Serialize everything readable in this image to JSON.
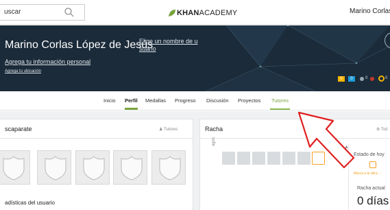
{
  "topbar": {
    "search_text": "uscar",
    "search_icon": "search-icon",
    "logo_strong": "KHAN",
    "logo_light": "ACADEMY",
    "user_name": "Marino Corlas"
  },
  "header": {
    "profile_name": "Marino Corlas López de Jesús",
    "pick_name_link": "Elige un nombre de u suario",
    "add_info_link": "Agrega tu información personal",
    "add_location_link": "Agrega tu ubicación",
    "badge_energy": "0",
    "badge_count": "0",
    "stat_a": "0",
    "stat_b": "0"
  },
  "nav": {
    "items": [
      {
        "label": "Inicio",
        "state": "normal"
      },
      {
        "label": "Perfil",
        "state": "active"
      },
      {
        "label": "Medallas",
        "state": "normal"
      },
      {
        "label": "Progreso",
        "state": "normal"
      },
      {
        "label": "Discusión",
        "state": "normal"
      },
      {
        "label": "Proyectos",
        "state": "normal"
      },
      {
        "label": "Tutores",
        "state": "highlighted"
      }
    ]
  },
  "showcase": {
    "title": "scaparate",
    "action": "Tutores",
    "stats_title": "adísticas del usuario"
  },
  "streak": {
    "title": "Racha",
    "action": "Tod",
    "y_label": "agos",
    "today_title": "Estado de hoy",
    "today_note": "Marca a la obra →",
    "current_label": "Racha actual",
    "current_value": "0 días"
  },
  "colors": {
    "header_bg": "#1b2b3a",
    "accent_green": "#7aa43f",
    "streak_orange": "#f4a020",
    "annotation_red": "#e02020"
  }
}
